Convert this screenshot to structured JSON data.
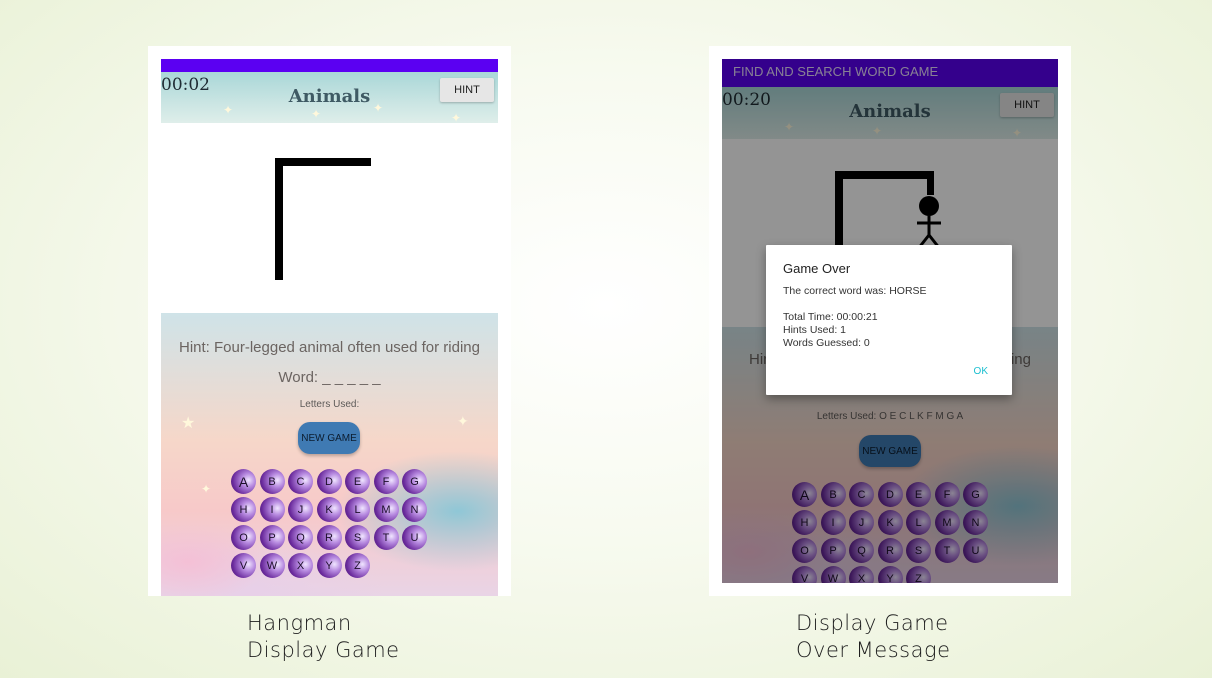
{
  "left_screen": {
    "timer": "00:02",
    "category": "Animals",
    "hint_button": "HINT",
    "hint_text": "Hint: Four-legged animal often used for riding",
    "word": "Word: _ _ _ _ _",
    "letters_used": "Letters Used:",
    "new_game": "NEW GAME",
    "keys": [
      [
        "A",
        "B",
        "C",
        "D",
        "E",
        "F",
        "G"
      ],
      [
        "H",
        "I",
        "J",
        "K",
        "L",
        "M",
        "N"
      ],
      [
        "O",
        "P",
        "Q",
        "R",
        "S",
        "T",
        "U"
      ],
      [
        "V",
        "W",
        "X",
        "Y",
        "Z"
      ]
    ]
  },
  "right_screen": {
    "app_title": "FIND AND SEARCH WORD GAME",
    "timer": "00:20",
    "category": "Animals",
    "hint_button": "HINT",
    "hint_partial_left": "Hir",
    "hint_partial_right": "ing",
    "letters_used": "Letters Used: O E C L K F M G A",
    "new_game": "NEW GAME",
    "keys": [
      [
        "A",
        "B",
        "C",
        "D",
        "E",
        "F",
        "G"
      ],
      [
        "H",
        "I",
        "J",
        "K",
        "L",
        "M",
        "N"
      ],
      [
        "O",
        "P",
        "Q",
        "R",
        "S",
        "T",
        "U"
      ],
      [
        "V",
        "W",
        "X",
        "Y",
        "Z"
      ]
    ],
    "dialog": {
      "title": "Game Over",
      "correct_word": "The correct word was: HORSE",
      "total_time": "Total Time: 00:00:21",
      "hints_used": "Hints Used: 1",
      "words_guessed": "Words Guessed: 0",
      "ok": "OK"
    }
  },
  "captions": {
    "left_line1": "Hangman",
    "left_line2": "Display Game",
    "right_line1": "Display Game",
    "right_line2": "Over Message"
  }
}
